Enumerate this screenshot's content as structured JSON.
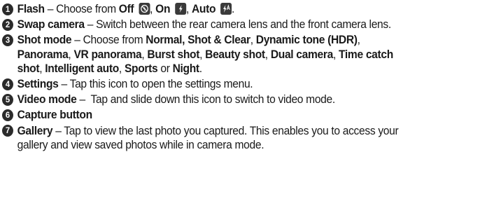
{
  "items": [
    {
      "num": "1",
      "title": "Flash",
      "sep": " – Choose from ",
      "opt_off": "Off",
      "comma1": ", ",
      "opt_on": "On",
      "comma2": ", ",
      "opt_auto": "Auto",
      "end": "."
    },
    {
      "num": "2",
      "title": "Swap camera",
      "text": " – Switch between the rear camera lens and the front camera lens."
    },
    {
      "num": "3",
      "title": "Shot mode",
      "sep": " – Choose from ",
      "modes": {
        "m1": "Normal, Shot & Clear",
        "m2": "Dynamic tone (HDR)",
        "m3": "Panorama",
        "m4": "VR panorama",
        "m5": "Burst shot",
        "m6": "Beauty shot",
        "m7": "Dual camera",
        "m8": "Time catch",
        "m8b": "shot",
        "m9": "Intelligent auto",
        "m10": "Sports",
        "m11": "Night"
      },
      "comma": ", ",
      "or": " or ",
      "end": "."
    },
    {
      "num": "4",
      "title": "Settings",
      "text": " – Tap this icon to open the settings menu."
    },
    {
      "num": "5",
      "title": "Video mode",
      "text": " –  Tap and slide down this icon to switch to video mode."
    },
    {
      "num": "6",
      "title": "Capture button"
    },
    {
      "num": "7",
      "title": "Gallery",
      "line1": " – Tap to view the last photo you captured. This enables you to access your",
      "line2": "gallery and view saved photos while in camera mode."
    }
  ],
  "icons": {
    "off": "flash-off-icon",
    "on": "flash-on-icon",
    "auto": "flash-auto-icon"
  }
}
